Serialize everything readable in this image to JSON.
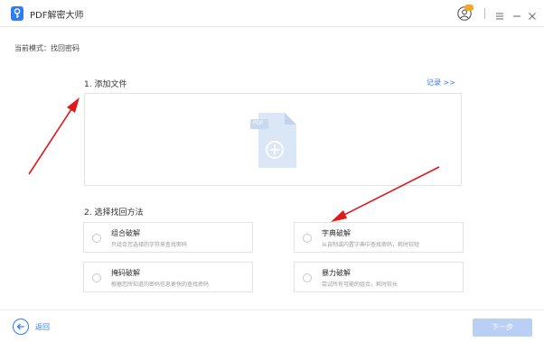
{
  "titlebar": {
    "app_title": "PDF解密大师",
    "vip_badge": "VIP",
    "accent_color": "#2f7cf6",
    "icons": [
      "key-logo-icon",
      "user-icon",
      "menu-icon",
      "minimize-icon",
      "close-icon"
    ]
  },
  "mode": {
    "text": "当前模式：找回密码"
  },
  "add_file": {
    "title": "1. 添加文件",
    "record_link": "记录 >>",
    "file_badge": "PDF"
  },
  "methods": {
    "title": "2. 选择找回方法",
    "items": [
      {
        "title": "组合破解",
        "desc": "只组合您选择的字符来查找密码"
      },
      {
        "title": "字典破解",
        "desc": "从自制或内置字典中查找密码，耗时较短"
      },
      {
        "title": "掩码破解",
        "desc": "根据您所知道的密码信息更快的查找密码"
      },
      {
        "title": "暴力破解",
        "desc": "尝试所有可能的组合，耗时较长"
      }
    ]
  },
  "footer": {
    "back_label": "返回",
    "next_label": "下一步"
  },
  "annotations": {
    "arrow_color": "#e0191a"
  }
}
